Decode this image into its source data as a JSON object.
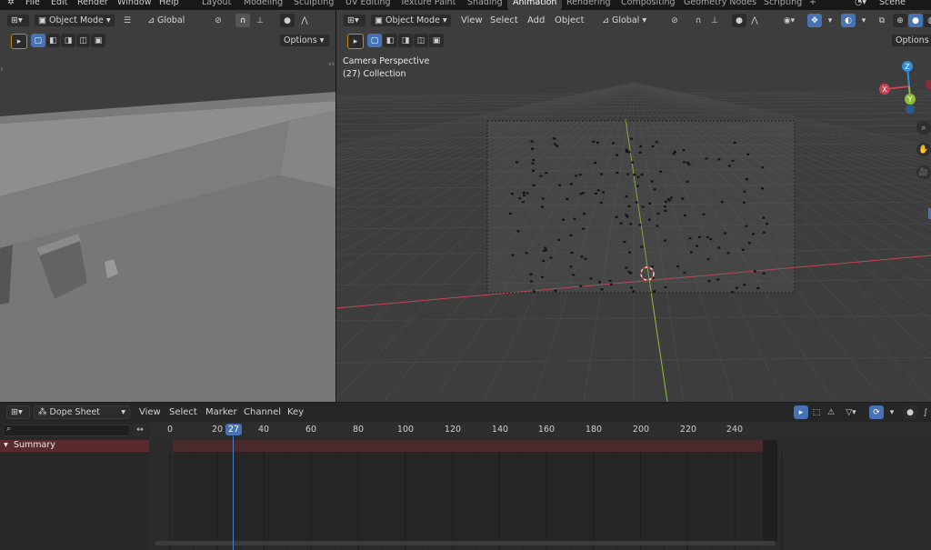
{
  "topbar": {
    "menus": [
      "File",
      "Edit",
      "Render",
      "Window",
      "Help"
    ],
    "workspaces": [
      "Layout",
      "Modeling",
      "Sculpting",
      "UV Editing",
      "Texture Paint",
      "Shading",
      "Animation",
      "Rendering",
      "Compositing",
      "Geometry Nodes",
      "Scripting"
    ],
    "active_workspace": "Animation",
    "add_tab": "+",
    "scene_label": "Scene"
  },
  "left_viewport": {
    "mode": "Object Mode",
    "orientation": "Global",
    "options": "Options"
  },
  "right_viewport": {
    "mode": "Object Mode",
    "menus": [
      "View",
      "Select",
      "Add",
      "Object"
    ],
    "orientation": "Global",
    "options": "Options",
    "overlay_title": "Camera Perspective",
    "overlay_sub": "(27) Collection",
    "gizmo": {
      "x": "X",
      "y": "Y",
      "z": "Z"
    },
    "colors": {
      "x_axis": "#c8434e",
      "y_axis": "#8bbf3a",
      "z_axis": "#2c8fe0"
    }
  },
  "dope_sheet": {
    "editor": "Dope Sheet",
    "menus": [
      "View",
      "Select",
      "Marker",
      "Channel",
      "Key"
    ],
    "search_placeholder": "",
    "channel": "Summary",
    "current_frame": "27",
    "current_frame_value": 27,
    "frame_ticks": [
      "0",
      "20",
      "40",
      "60",
      "80",
      "100",
      "120",
      "140",
      "160",
      "180",
      "200",
      "220",
      "240"
    ],
    "accent": "#4772b3"
  }
}
